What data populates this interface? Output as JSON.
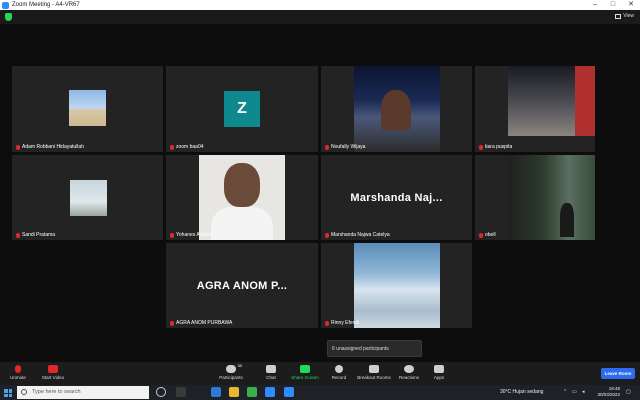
{
  "window": {
    "title": "Zoom Meeting - A4-VR67"
  },
  "topbar": {
    "view_label": "View"
  },
  "tiles": [
    {
      "name": "Adam Robbani Hidayatullah"
    },
    {
      "name": "zoom baa04",
      "avatar_letter": "Z"
    },
    {
      "name": "Noufally Wijaya"
    },
    {
      "name": "tiara puspita"
    },
    {
      "name": "Sandi Pratama"
    },
    {
      "name": "Yohanes Adrian"
    },
    {
      "name": "Marshanda Najwa Catelya",
      "big_label": "Marshanda  Naj..."
    },
    {
      "name": "obell"
    },
    {
      "name": "AGRA ANOM PURBAWA",
      "big_label": "AGRA ANOM P..."
    },
    {
      "name": "Rinny Efendi"
    }
  ],
  "unassigned": {
    "label": "6 unassigned participants"
  },
  "toolbar": {
    "unmute": "Unmute",
    "start_video": "Start Video",
    "participants": "Participants",
    "participants_count": "30",
    "chat": "Chat",
    "share_screen": "Share Screen",
    "record": "Record",
    "breakout": "Breakout Rooms",
    "reactions": "Reactions",
    "apps": "Apps",
    "leave": "Leave Room"
  },
  "taskbar": {
    "search_placeholder": "Type here to search",
    "weather": "30°C  Hujan sedang",
    "time": "18:48",
    "date": "30/03/2022"
  },
  "colors": {
    "accent_green": "#23d959",
    "leave_blue": "#2d6cf0",
    "mic_red": "#e02828",
    "avatar_teal": "#0e8a8f"
  }
}
